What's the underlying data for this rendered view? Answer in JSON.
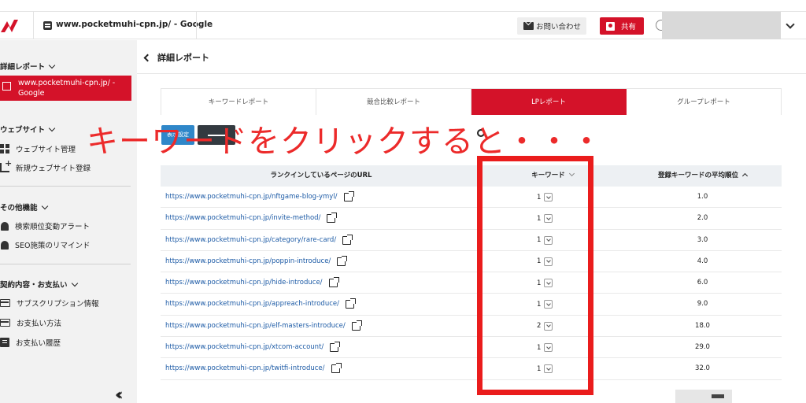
{
  "header": {
    "site_title": "www.pocketmuhi-cpn.jp/ - Google",
    "contact_label": "お問い合わせ",
    "share_label": "共有"
  },
  "sidebar": {
    "group_report": "詳細レポート",
    "active_item": "www.pocketmuhi-cpn.jp/ - Google",
    "group_website": "ウェブサイト",
    "website_manage": "ウェブサイト管理",
    "website_add": "新規ウェブサイト登録",
    "group_other": "その他機能",
    "rank_alert": "検索順位変動アラート",
    "seo_remind": "SEO施策のリマインド",
    "group_contract": "契約内容・お支払い",
    "subscription": "サブスクリプション情報",
    "payment_method": "お支払い方法",
    "payment_history": "お支払い履歴",
    "collapse_icon": "double-chevron-left-icon"
  },
  "page": {
    "title": "詳細レポート",
    "tabs": [
      "キーワードレポート",
      "競合比較レポート",
      "LPレポート",
      "グループレポート"
    ],
    "active_tab": 2,
    "display_button": "表示設定",
    "overlay_caption": "キーワードをクリックすると・・・"
  },
  "table": {
    "headers": {
      "url": "ランクインしているページのURL",
      "keyword": "キーワード",
      "avg_rank": "登録キーワードの平均順位"
    },
    "rows": [
      {
        "url": "https://www.pocketmuhi-cpn.jp/nftgame-blog-ymyl/",
        "kw": "1",
        "avg": "1.0"
      },
      {
        "url": "https://www.pocketmuhi-cpn.jp/invite-method/",
        "kw": "1",
        "avg": "2.0"
      },
      {
        "url": "https://www.pocketmuhi-cpn.jp/category/rare-card/",
        "kw": "1",
        "avg": "3.0"
      },
      {
        "url": "https://www.pocketmuhi-cpn.jp/poppin-introduce/",
        "kw": "1",
        "avg": "4.0"
      },
      {
        "url": "https://www.pocketmuhi-cpn.jp/hide-introduce/",
        "kw": "1",
        "avg": "6.0"
      },
      {
        "url": "https://www.pocketmuhi-cpn.jp/appreach-introduce/",
        "kw": "1",
        "avg": "9.0"
      },
      {
        "url": "https://www.pocketmuhi-cpn.jp/elf-masters-introduce/",
        "kw": "2",
        "avg": "18.0"
      },
      {
        "url": "https://www.pocketmuhi-cpn.jp/xtcom-account/",
        "kw": "1",
        "avg": "29.0"
      },
      {
        "url": "https://www.pocketmuhi-cpn.jp/twitfi-introduce/",
        "kw": "1",
        "avg": "32.0"
      }
    ]
  },
  "colors": {
    "brand_red": "#d41229",
    "annotation_red": "#ea1c1c",
    "link_blue": "#1d5ba6",
    "button_blue": "#2f87c9"
  }
}
